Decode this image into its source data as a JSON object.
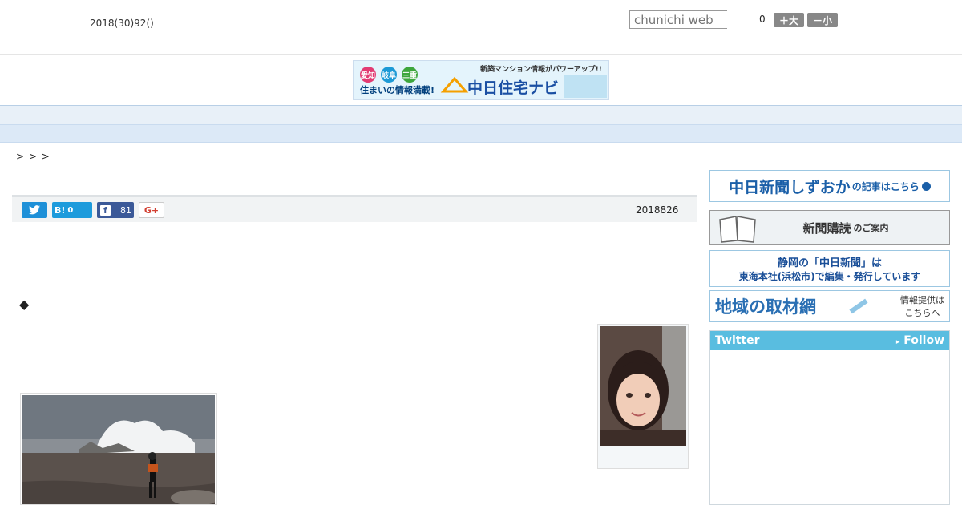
{
  "header": {
    "date": "2018(30)92()",
    "search_placeholder": "chunichi web",
    "font_size_value": "0",
    "font_bigger": "＋大",
    "font_smaller": "－小"
  },
  "banner": {
    "tags": [
      "愛知",
      "岐阜",
      "三重"
    ],
    "tagline": "住まいの情報満載!",
    "promo": "新築マンション情報がパワーアップ!!",
    "name": "中日住宅ナビ"
  },
  "nav": {
    "items": [
      "",
      "",
      "",
      "",
      "",
      "",
      "",
      "",
      ""
    ]
  },
  "breadcrumb": "> > >",
  "share": {
    "hatena_count": "0",
    "facebook_count": "81",
    "hatena_label": "B!",
    "gplus_label": "G+"
  },
  "article": {
    "published": "2018826",
    "bullet": "◆"
  },
  "sidebar": {
    "ad1": "中日新聞しずおか",
    "ad1_suffix": "の記事はこちら",
    "ad2": "新聞購読",
    "ad2_suffix": "のご案内",
    "ad3_line1": "静岡の「中日新聞」は",
    "ad3_line2": "東海本社(浜松市)で編集・発行しています",
    "ad4": "地域の取材網",
    "ad4_side1": "情報提供は",
    "ad4_side2": "こちらへ",
    "twitter_title": "Twitter",
    "twitter_follow": "Follow"
  },
  "colors": {
    "nav_bg": "#e8f0f8",
    "twitter_head": "#59bde0",
    "share_twitter": "#1e90d8",
    "share_facebook": "#3b5998"
  }
}
